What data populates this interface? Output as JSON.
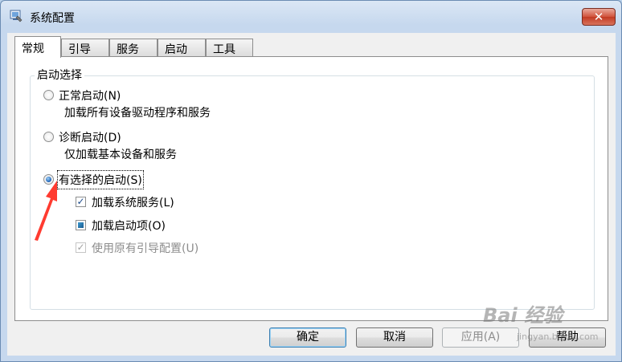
{
  "window": {
    "title": "系统配置",
    "close_label": "✕"
  },
  "tabs": [
    "常规",
    "引导",
    "服务",
    "启动",
    "工具"
  ],
  "startup_group": {
    "title": "启动选择",
    "options": [
      {
        "label": "正常启动(N)",
        "description": "加载所有设备驱动程序和服务",
        "checked": false
      },
      {
        "label": "诊断启动(D)",
        "description": "仅加载基本设备和服务",
        "checked": false
      },
      {
        "label": "有选择的启动(S)",
        "checked": true
      }
    ],
    "selective": {
      "load_services": {
        "label": "加载系统服务(L)",
        "state": "checked",
        "mark": "✓"
      },
      "load_startup": {
        "label": "加载启动项(O)",
        "state": "mixed"
      },
      "use_original_boot": {
        "label": "使用原有引导配置(U)",
        "state": "checked-disabled",
        "mark": "✓"
      }
    }
  },
  "buttons": {
    "ok": "确定",
    "cancel": "取消",
    "apply": "应用(A)",
    "help": "帮助"
  },
  "watermark": {
    "logo": "Bai 经验",
    "url": "jingyan.baidu.com"
  },
  "colors": {
    "annotation_arrow": "#ff3b30",
    "title_bar": "#c6d8ee",
    "radio_selected": "#1a5fb4"
  }
}
